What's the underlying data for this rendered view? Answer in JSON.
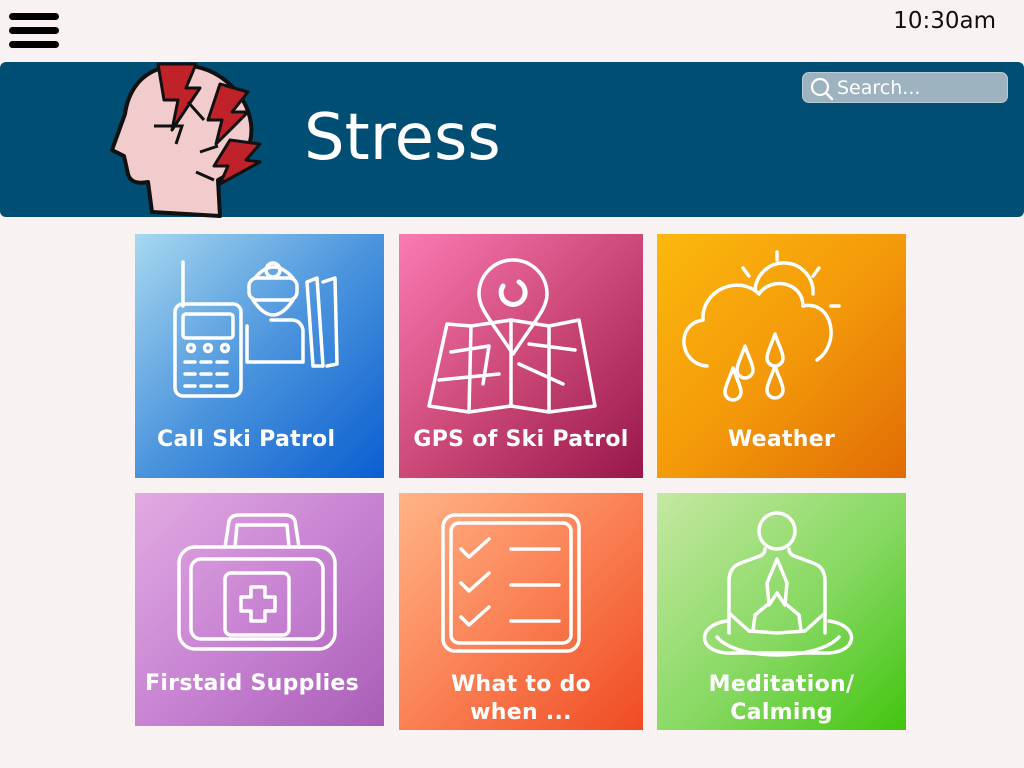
{
  "status_bar": {
    "time": "10:30am"
  },
  "banner": {
    "title": "Stress",
    "icon": "stressed-head-icon",
    "background_color": "#004e74"
  },
  "search": {
    "placeholder": "Search..."
  },
  "tiles": [
    {
      "label": "Call Ski Patrol",
      "icon": "ski-patrol-radio-icon"
    },
    {
      "label": "GPS of Ski Patrol",
      "icon": "map-pin-icon"
    },
    {
      "label": "Weather",
      "icon": "rain-cloud-sun-icon"
    },
    {
      "label": "Firstaid Supplies",
      "icon": "first-aid-kit-icon"
    },
    {
      "label_line1": "What to do",
      "label_line2": "when ...",
      "icon": "checklist-icon"
    },
    {
      "label_line1": "Meditation/",
      "label_line2": "Calming",
      "icon": "meditation-icon"
    }
  ]
}
